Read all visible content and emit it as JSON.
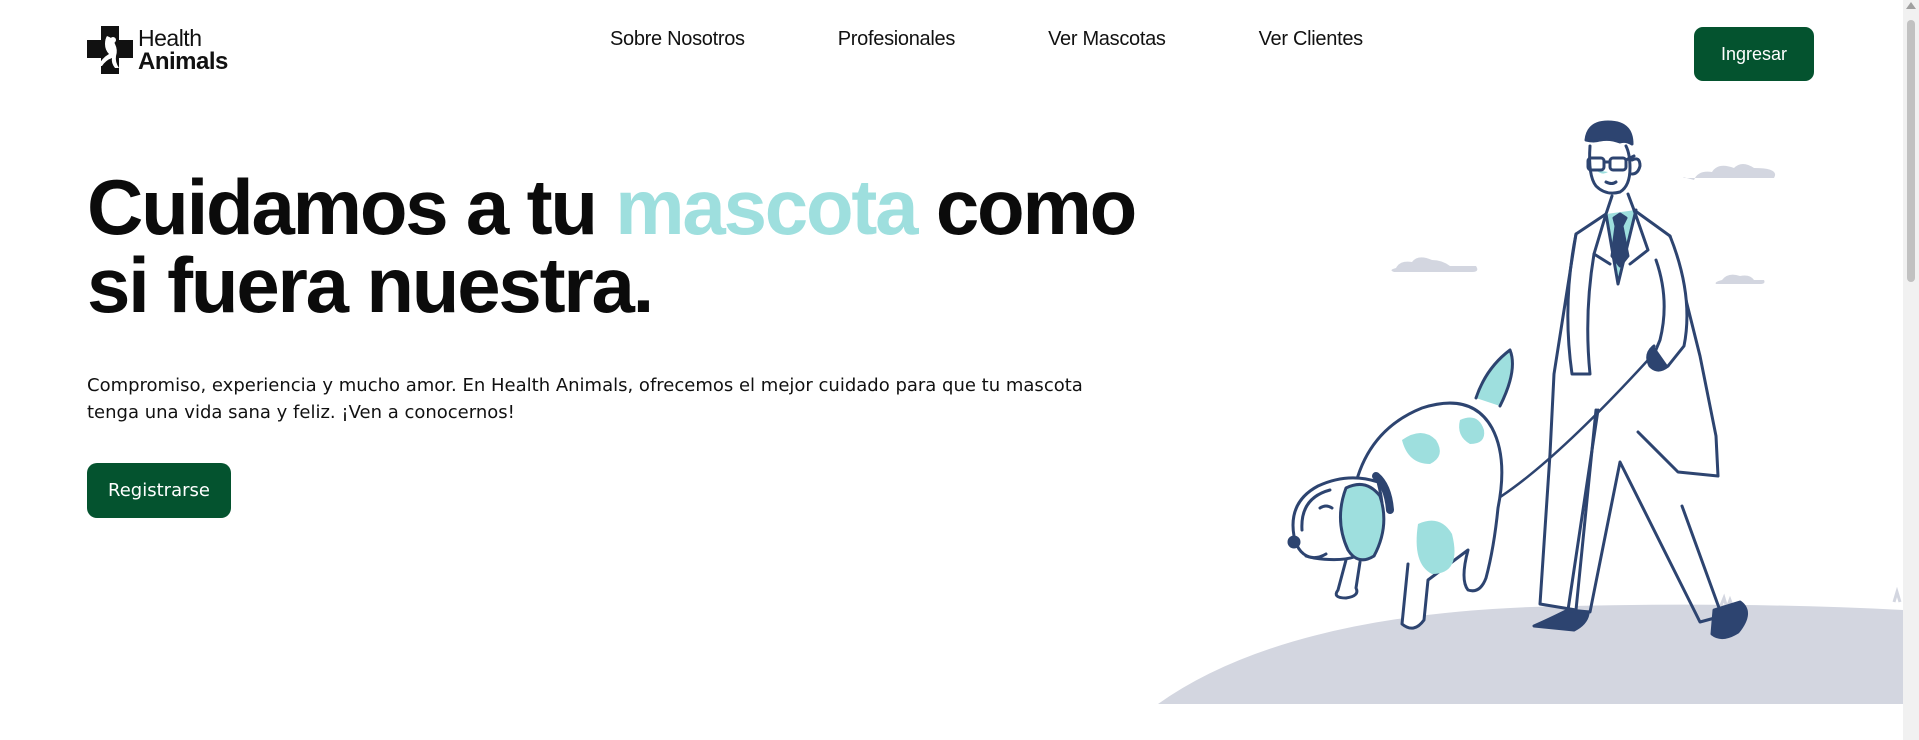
{
  "brand": {
    "line1": "Health",
    "line2": "Animals"
  },
  "nav": {
    "items": [
      {
        "label": "Sobre Nosotros"
      },
      {
        "label": "Profesionales"
      },
      {
        "label": "Ver Mascotas"
      },
      {
        "label": "Ver Clientes"
      }
    ],
    "login_label": "Ingresar"
  },
  "hero": {
    "title_part1": "Cuidamos a tu ",
    "title_highlight": "mascota",
    "title_part2": " como si fuera nuestra.",
    "subtitle": "Compromiso, experiencia y mucho amor. En Health Animals, ofrecemos el mejor cuidado para que tu mascota tenga una vida sana y feliz. ¡Ven a conocernos!",
    "cta_label": "Registrarse"
  },
  "colors": {
    "brand_green": "#04532f",
    "accent_teal": "#9edfde",
    "ink_navy": "#2d4470",
    "ground_gray": "#d3d6e0"
  },
  "icons": {
    "logo": "cross-with-pet-silhouette-icon",
    "illustration": "vet-walking-dog-illustration"
  }
}
